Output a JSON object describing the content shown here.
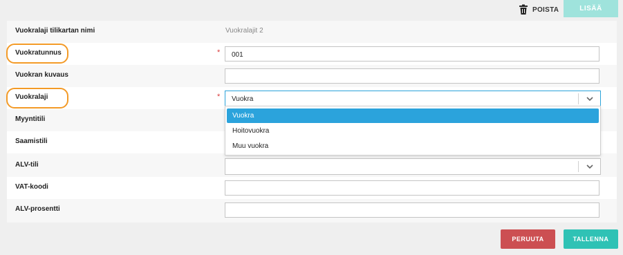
{
  "toolbar": {
    "delete_label": "POISTA",
    "add_label": "LISÄÄ"
  },
  "fields": {
    "account_name": {
      "label": "Vuokralaji tilikartan nimi",
      "value": "Vuokralajit 2"
    },
    "rent_code": {
      "label": "Vuokratunnus",
      "required_mark": "*",
      "value": "001"
    },
    "rent_description": {
      "label": "Vuokran kuvaus",
      "value": ""
    },
    "rent_type": {
      "label": "Vuokralaji",
      "required_mark": "*",
      "value": "Vuokra"
    },
    "sales_account": {
      "label": "Myyntitili"
    },
    "receivables_account": {
      "label": "Saamistili"
    },
    "vat_account": {
      "label": "ALV-tili",
      "value": ""
    },
    "vat_code": {
      "label": "VAT-koodi",
      "value": ""
    },
    "vat_percent": {
      "label": "ALV-prosentti",
      "value": ""
    }
  },
  "rent_type_dropdown": {
    "options": [
      "Vuokra",
      "Hoitovuokra",
      "Muu vuokra"
    ],
    "selected_index": 0
  },
  "footer": {
    "cancel_label": "PERUUTA",
    "save_label": "TALLENNA"
  },
  "colors": {
    "highlight_ring": "#f39a26",
    "selected_option": "#2ba3dc",
    "cancel_button": "#cc4f52",
    "save_button": "#2fc2b5",
    "add_button_disabled": "#9fe3dc",
    "required_mark": "#d93a3a"
  },
  "icons": {
    "delete": "trash-icon",
    "dropdown": "chevron-down-icon"
  }
}
